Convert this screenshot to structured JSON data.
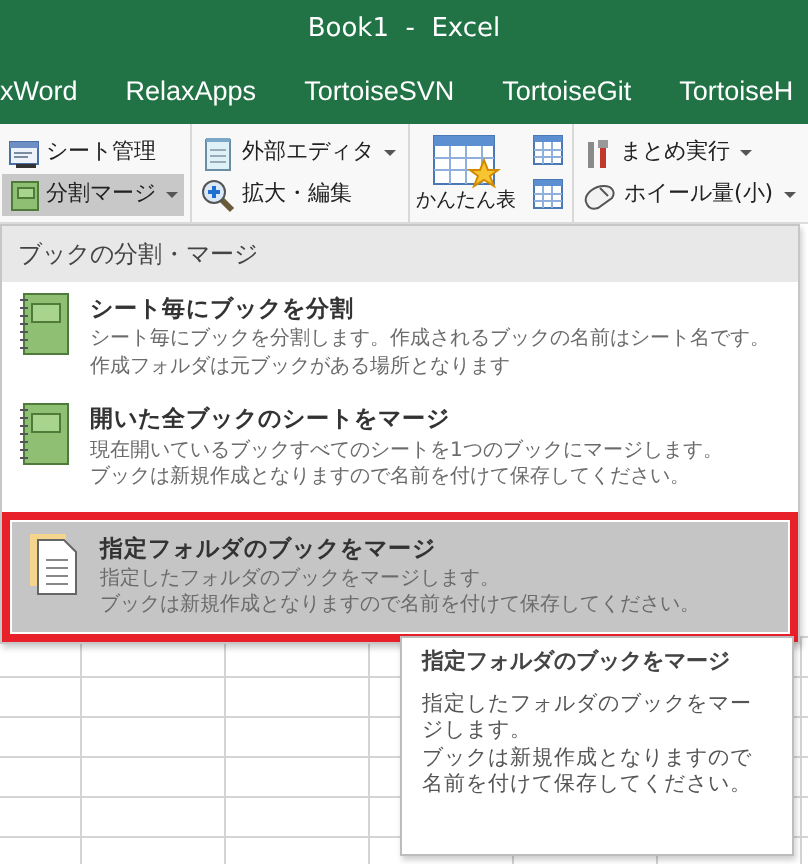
{
  "window": {
    "title": "Book1  -  Excel"
  },
  "ribbon_tabs": [
    {
      "label": "xWord"
    },
    {
      "label": "RelaxApps"
    },
    {
      "label": "TortoiseSVN"
    },
    {
      "label": "TortoiseGit"
    },
    {
      "label": "TortoiseH"
    }
  ],
  "ribbon_groups": [
    [
      {
        "kind": "small",
        "label": "シート管理",
        "dropdown": false,
        "pressed": false
      },
      {
        "kind": "small",
        "label": "分割マージ",
        "dropdown": true,
        "pressed": true
      }
    ],
    [
      {
        "kind": "small",
        "label": "外部エディタ",
        "dropdown": true,
        "pressed": false
      },
      {
        "kind": "small",
        "label": "拡大・編集",
        "dropdown": false,
        "pressed": false
      }
    ],
    [
      {
        "kind": "large",
        "label": "かんたん表",
        "pressed": false
      },
      {
        "kind": "icon",
        "pressed": false
      },
      {
        "kind": "icon",
        "pressed": false
      }
    ],
    [
      {
        "kind": "small",
        "label": "まとめ実行",
        "dropdown": true,
        "pressed": false
      },
      {
        "kind": "small",
        "label": "ホイール量(小)",
        "dropdown": true,
        "pressed": false
      }
    ]
  ],
  "menu": {
    "header": "ブックの分割・マージ",
    "items": [
      {
        "title": "シート毎にブックを分割",
        "description": [
          "シート毎にブックを分割します。作成されるブックの名前はシート名です。",
          "作成フォルダは元ブックがある場所となります"
        ],
        "selected": false,
        "framed": false
      },
      {
        "title": "開いた全ブックのシートをマージ",
        "description": [
          "現在開いているブックすべてのシートを1つのブックにマージします。",
          "ブックは新規作成となりますので名前を付けて保存してください。"
        ],
        "selected": false,
        "framed": false
      },
      {
        "title": "指定フォルダのブックをマージ",
        "description": [
          "指定したフォルダのブックをマージします。",
          "ブックは新規作成となりますので名前を付けて保存してください。"
        ],
        "selected": true,
        "framed": true
      }
    ]
  },
  "tooltip": {
    "title": "指定フォルダのブックをマージ",
    "paragraphs": [
      "指定したフォルダのブックをマージします。",
      "ブックは新規作成となりますので名前を付けて保存してください。"
    ]
  }
}
